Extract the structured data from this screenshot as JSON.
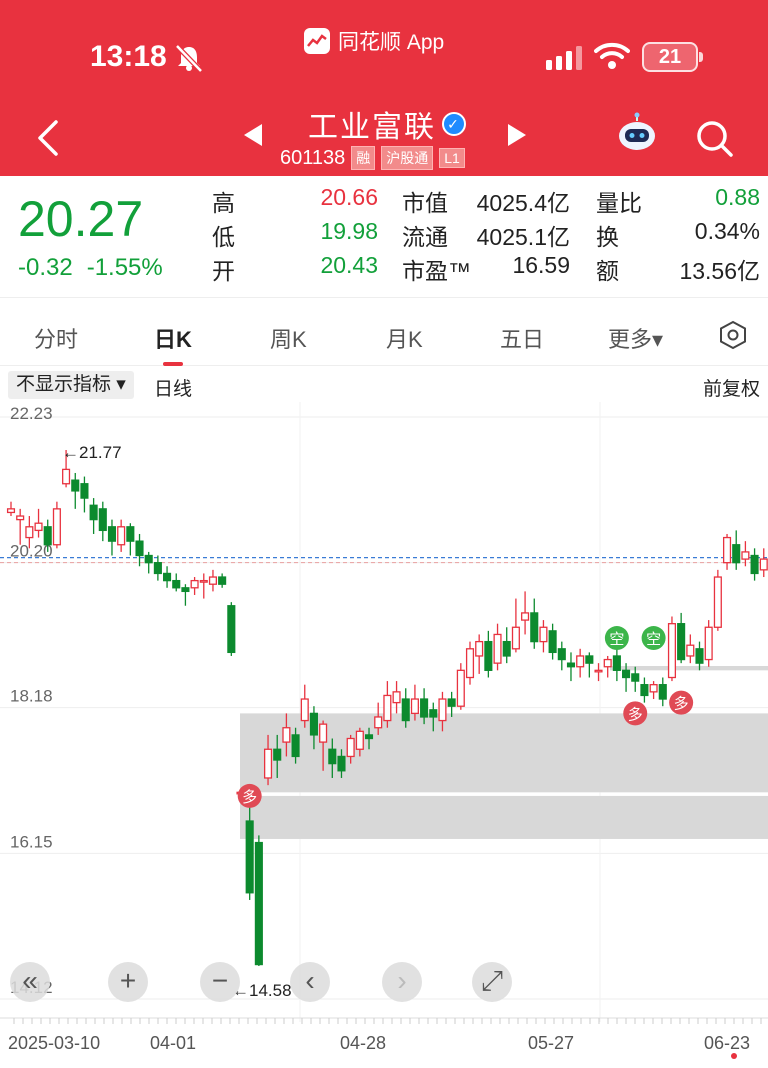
{
  "status_bar": {
    "time": "13:18",
    "app_name": "同花顺 App",
    "battery": "21"
  },
  "stock": {
    "name": "工业富联",
    "code": "601138",
    "tags": [
      "融",
      "沪股通",
      "L1"
    ]
  },
  "quote": {
    "price": "20.27",
    "change": "-0.32",
    "change_pct": "-1.55%",
    "rows": [
      {
        "l1": "高",
        "v1": "20.66",
        "l2": "市值",
        "v2": "4025.4亿",
        "l3": "量比",
        "v3": "0.88",
        "c1": "#e8323f",
        "c3": "#12a03a"
      },
      {
        "l1": "低",
        "v1": "19.98",
        "l2": "流通",
        "v2": "4025.1亿",
        "l3": "换",
        "v3": "0.34%",
        "c1": "#12a03a",
        "c3": "#222"
      },
      {
        "l1": "开",
        "v1": "20.43",
        "l2": "市盈™",
        "v2": "16.59",
        "l3": "额",
        "v3": "13.56亿",
        "c1": "#12a03a",
        "c3": "#222"
      }
    ]
  },
  "tabs": [
    "分时",
    "日K",
    "周K",
    "月K",
    "五日",
    "更多▾"
  ],
  "active_tab": "日K",
  "indicator_bar": {
    "selector": "不显示指标 ▾",
    "line_type": "日线",
    "adjust": "前复权"
  },
  "chart_data": {
    "type": "candlestick",
    "y_ticks": [
      "22.23",
      "20.20",
      "18.18",
      "16.15",
      "14.12"
    ],
    "x_ticks": [
      "2025-03-10",
      "04-01",
      "04-28",
      "05-27",
      "06-23"
    ],
    "max_label": "←21.77",
    "min_label": "←14.58",
    "ylim": [
      14.12,
      22.23
    ],
    "last_price": 20.27,
    "candles": [
      [
        20.9,
        20.95,
        21.05,
        20.85
      ],
      [
        20.8,
        20.85,
        20.95,
        20.45
      ],
      [
        20.55,
        20.7,
        20.85,
        20.4
      ],
      [
        20.65,
        20.75,
        20.95,
        20.55
      ],
      [
        20.7,
        20.45,
        20.8,
        20.35
      ],
      [
        20.45,
        20.95,
        21.05,
        20.4
      ],
      [
        21.3,
        21.5,
        21.77,
        21.25
      ],
      [
        21.35,
        21.2,
        21.45,
        20.95
      ],
      [
        21.3,
        21.1,
        21.4,
        20.9
      ],
      [
        21.0,
        20.8,
        21.1,
        20.6
      ],
      [
        20.95,
        20.65,
        21.05,
        20.5
      ],
      [
        20.7,
        20.5,
        20.8,
        20.3
      ],
      [
        20.45,
        20.7,
        20.8,
        20.35
      ],
      [
        20.7,
        20.5,
        20.75,
        20.3
      ],
      [
        20.5,
        20.3,
        20.6,
        20.15
      ],
      [
        20.3,
        20.2,
        20.35,
        20.05
      ],
      [
        20.2,
        20.05,
        20.3,
        19.95
      ],
      [
        20.05,
        19.95,
        20.15,
        19.85
      ],
      [
        19.95,
        19.85,
        20.05,
        19.8
      ],
      [
        19.85,
        19.8,
        19.9,
        19.6
      ],
      [
        19.85,
        19.95,
        20.0,
        19.75
      ],
      [
        19.95,
        19.95,
        20.05,
        19.7
      ],
      [
        19.9,
        20.0,
        20.1,
        19.8
      ],
      [
        20.0,
        19.9,
        20.05,
        19.85
      ],
      [
        19.6,
        18.95,
        19.65,
        18.9
      ],
      [
        17.0,
        17.0,
        17.0,
        17.0
      ],
      [
        16.6,
        15.6,
        16.9,
        15.5
      ],
      [
        16.3,
        14.6,
        16.4,
        14.58
      ],
      [
        17.2,
        17.6,
        17.8,
        17.1
      ],
      [
        17.6,
        17.45,
        17.8,
        17.2
      ],
      [
        17.7,
        17.9,
        18.1,
        17.5
      ],
      [
        17.8,
        17.5,
        17.9,
        17.4
      ],
      [
        18.0,
        18.3,
        18.5,
        17.9
      ],
      [
        18.1,
        17.8,
        18.2,
        17.6
      ],
      [
        17.7,
        17.95,
        18.0,
        17.3
      ],
      [
        17.6,
        17.4,
        17.75,
        17.2
      ],
      [
        17.5,
        17.3,
        17.6,
        17.2
      ],
      [
        17.5,
        17.75,
        17.8,
        17.4
      ],
      [
        17.6,
        17.85,
        17.9,
        17.5
      ],
      [
        17.8,
        17.75,
        17.9,
        17.6
      ],
      [
        17.9,
        18.05,
        18.25,
        17.8
      ],
      [
        18.0,
        18.35,
        18.55,
        17.9
      ],
      [
        18.25,
        18.4,
        18.55,
        18.1
      ],
      [
        18.3,
        18.0,
        18.45,
        17.9
      ],
      [
        18.1,
        18.3,
        18.5,
        18.0
      ],
      [
        18.3,
        18.05,
        18.45,
        17.95
      ],
      [
        18.15,
        18.05,
        18.25,
        17.85
      ],
      [
        18.0,
        18.3,
        18.4,
        17.85
      ],
      [
        18.3,
        18.2,
        18.4,
        18.05
      ],
      [
        18.2,
        18.7,
        18.8,
        18.15
      ],
      [
        18.6,
        19.0,
        19.1,
        18.5
      ],
      [
        18.9,
        19.1,
        19.2,
        18.65
      ],
      [
        19.1,
        18.7,
        19.25,
        18.6
      ],
      [
        18.8,
        19.2,
        19.35,
        18.7
      ],
      [
        19.1,
        18.9,
        19.3,
        18.8
      ],
      [
        19.0,
        19.3,
        19.7,
        18.95
      ],
      [
        19.4,
        19.5,
        19.8,
        19.2
      ],
      [
        19.5,
        19.1,
        19.7,
        19.0
      ],
      [
        19.1,
        19.3,
        19.4,
        18.95
      ],
      [
        19.25,
        18.95,
        19.35,
        18.85
      ],
      [
        19.0,
        18.85,
        19.1,
        18.7
      ],
      [
        18.8,
        18.75,
        18.95,
        18.55
      ],
      [
        18.75,
        18.9,
        19.0,
        18.6
      ],
      [
        18.9,
        18.8,
        18.95,
        18.6
      ],
      [
        18.7,
        18.7,
        18.8,
        18.55
      ],
      [
        18.75,
        18.85,
        18.9,
        18.6
      ],
      [
        18.9,
        18.7,
        19.0,
        18.55
      ],
      [
        18.7,
        18.6,
        18.8,
        18.4
      ],
      [
        18.65,
        18.55,
        18.75,
        18.4
      ],
      [
        18.5,
        18.35,
        18.6,
        18.25
      ],
      [
        18.4,
        18.5,
        18.55,
        18.3
      ],
      [
        18.5,
        18.3,
        18.6,
        18.2
      ],
      [
        18.6,
        19.35,
        19.45,
        18.55
      ],
      [
        19.35,
        18.85,
        19.5,
        18.8
      ],
      [
        18.9,
        19.05,
        19.2,
        18.8
      ],
      [
        19.0,
        18.8,
        19.1,
        18.7
      ],
      [
        18.85,
        19.3,
        19.4,
        18.75
      ],
      [
        19.3,
        20.0,
        20.1,
        19.25
      ],
      [
        20.2,
        20.55,
        20.6,
        20.1
      ],
      [
        20.45,
        20.2,
        20.65,
        20.1
      ],
      [
        20.25,
        20.35,
        20.5,
        20.15
      ],
      [
        20.3,
        20.05,
        20.4,
        19.95
      ],
      [
        20.1,
        20.25,
        20.4,
        20.0
      ],
      [
        20.4,
        20.7,
        20.8,
        20.3
      ],
      [
        20.6,
        20.3,
        20.75,
        20.2
      ],
      [
        20.3,
        20.6,
        21.05,
        20.25
      ],
      [
        20.8,
        21.1,
        21.3,
        20.7
      ],
      [
        21.1,
        21.4,
        21.55,
        21.0
      ],
      [
        21.1,
        20.4,
        21.2,
        20.3
      ],
      [
        20.6,
        21.05,
        21.3,
        20.5
      ],
      [
        20.85,
        20.5,
        21.05,
        20.4
      ],
      [
        20.95,
        21.5,
        21.6,
        20.85
      ],
      [
        21.0,
        20.6,
        21.2,
        20.4
      ],
      [
        20.6,
        20.45,
        20.75,
        20.1
      ]
    ],
    "gap_zones": [
      [
        18.1,
        17.0,
        240
      ],
      [
        16.95,
        16.35,
        240
      ],
      [
        18.76,
        18.7,
        610
      ]
    ],
    "tags": [
      {
        "t": "多",
        "i": 26,
        "v": 16.95,
        "kind": "red-circle"
      },
      {
        "t": "空",
        "i": 66,
        "v": 19.15,
        "kind": "green-circle"
      },
      {
        "t": "空",
        "i": 70,
        "v": 19.15,
        "kind": "green-circle"
      },
      {
        "t": "多",
        "i": 68,
        "v": 18.1,
        "kind": "red-circle"
      },
      {
        "t": "多",
        "i": 73,
        "v": 18.25,
        "kind": "red-circle"
      }
    ]
  },
  "controls": [
    "«",
    "+",
    "−",
    "‹",
    "›",
    "⤢"
  ]
}
